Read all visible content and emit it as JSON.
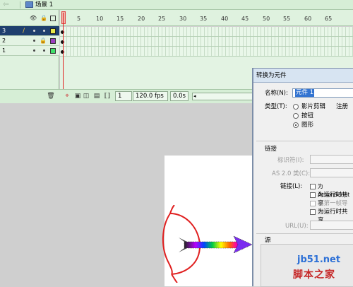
{
  "topbar": {
    "scene_label": "场景 1",
    "back_icon": "left-arrow-icon",
    "scene_icon": "scene-icon"
  },
  "timeline": {
    "header_icons": [
      "eye-icon",
      "lock-icon",
      "outline-square-icon"
    ],
    "layers": [
      {
        "number": "3",
        "selected": true,
        "color": "#e8e84a",
        "editing": true,
        "locked": false
      },
      {
        "number": "2",
        "selected": false,
        "color": "#9b3ec0",
        "editing": false,
        "locked": true
      },
      {
        "number": "1",
        "selected": false,
        "color": "#3fe06a",
        "editing": false,
        "locked": false
      }
    ],
    "ruler_ticks": [
      "5",
      "10",
      "15",
      "20",
      "25",
      "30",
      "35",
      "40",
      "45",
      "50",
      "55",
      "60",
      "65"
    ],
    "current_frame": "1",
    "fps": "120.0 fps",
    "elapsed": "0.0s"
  },
  "dialog": {
    "title": "转换为元件",
    "name_label": "名称(N):",
    "name_value": "元件 1",
    "type_label": "类型(T):",
    "type_options": [
      "影片剪辑",
      "按钮",
      "图形"
    ],
    "type_selected": "图形",
    "register_label": "注册",
    "linkage_section": "链接",
    "identifier_label": "标识符(I):",
    "as_class_label": "AS 2.0 类(C):",
    "linkage_label": "链接(L):",
    "linkage_options": [
      "为 ActionScript",
      "为运行时共享",
      "在第一帧导出",
      "为运行时共享"
    ],
    "url_label": "URL(U):",
    "source_section": "源"
  },
  "watermark": {
    "site": "jb51.net",
    "brand": "脚本之家"
  }
}
